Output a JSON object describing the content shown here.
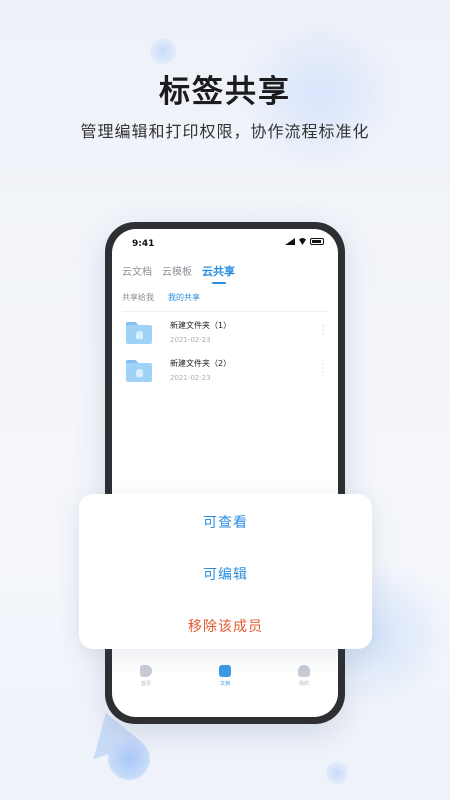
{
  "headline": "标签共享",
  "subline": "管理编辑和打印权限，协作流程标准化",
  "phone": {
    "status": {
      "time": "9:41"
    },
    "tabs": [
      {
        "label": "云文档",
        "active": false
      },
      {
        "label": "云模板",
        "active": false
      },
      {
        "label": "云共享",
        "active": true
      }
    ],
    "subtabs": [
      {
        "label": "共享给我",
        "active": false
      },
      {
        "label": "我的共享",
        "active": true
      }
    ],
    "folders": [
      {
        "name": "新建文件夹（1）",
        "date": "2021-02-23"
      },
      {
        "name": "新建文件夹（2）",
        "date": "2021-02-23"
      }
    ],
    "bottom_nav": [
      {
        "label": "首页",
        "icon": "home-icon"
      },
      {
        "label": "文档",
        "icon": "document-icon",
        "active": true
      },
      {
        "label": "我的",
        "icon": "user-icon"
      }
    ]
  },
  "action_sheet": {
    "view": "可查看",
    "edit": "可编辑",
    "remove": "移除该成员"
  },
  "colors": {
    "accent": "#2a8ee0",
    "danger": "#e35a2e"
  }
}
